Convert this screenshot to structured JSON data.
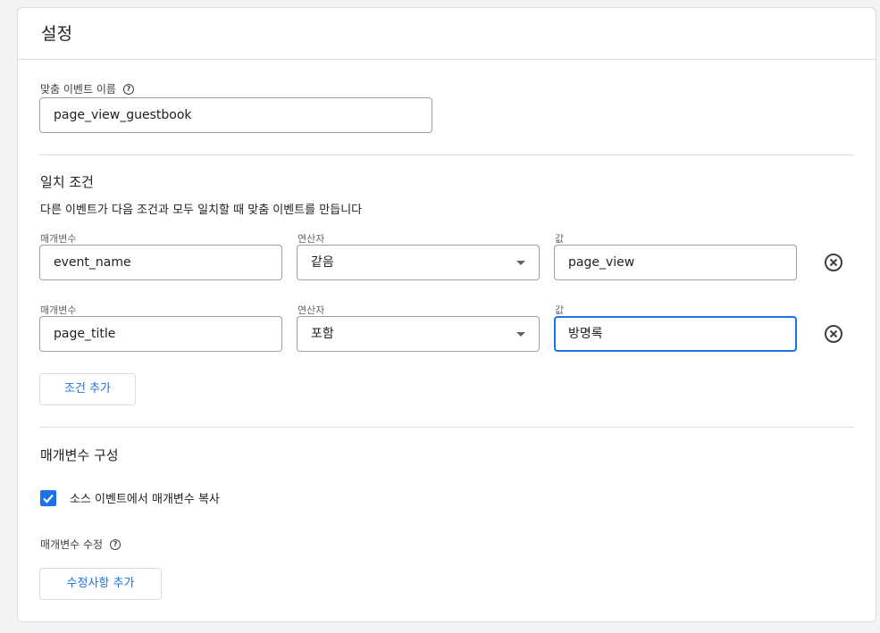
{
  "card": {
    "title": "설정"
  },
  "custom_event": {
    "label": "맞춤 이벤트 이름",
    "help_icon": "help-icon",
    "value": "page_view_guestbook"
  },
  "match": {
    "title": "일치 조건",
    "description": "다른 이벤트가 다음 조건과 모두 일치할 때 맞춤 이벤트를 만듭니다",
    "conditions": [
      {
        "parameter_label": "매개변수",
        "parameter_value": "event_name",
        "operator_label": "연산자",
        "operator_value": "같음",
        "value_label": "값",
        "value_value": "page_view",
        "remove_icon": "remove-circle-icon"
      },
      {
        "parameter_label": "매개변수",
        "parameter_value": "page_title",
        "operator_label": "연산자",
        "operator_value": "포함",
        "value_label": "값",
        "value_value": "방명록",
        "remove_icon": "remove-circle-icon"
      }
    ],
    "add_condition_label": "조건 추가"
  },
  "params": {
    "title": "매개변수 구성",
    "copy_checkbox_label": "소스 이벤트에서 매개변수 복사",
    "copy_checked": true,
    "modify_label": "매개변수 수정",
    "add_modification_label": "수정사항 추가"
  },
  "colors": {
    "accent": "#1a73e8",
    "border": "#dadce0",
    "background": "#f1f3f4"
  }
}
